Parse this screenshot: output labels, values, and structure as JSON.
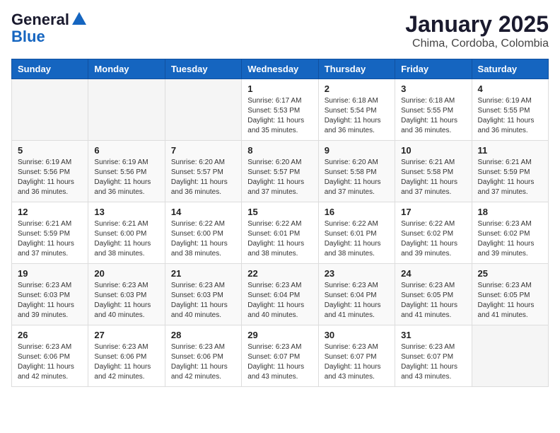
{
  "header": {
    "logo_line1": "General",
    "logo_line2": "Blue",
    "title": "January 2025",
    "subtitle": "Chima, Cordoba, Colombia"
  },
  "days_of_week": [
    "Sunday",
    "Monday",
    "Tuesday",
    "Wednesday",
    "Thursday",
    "Friday",
    "Saturday"
  ],
  "weeks": [
    [
      {
        "num": "",
        "sunrise": "",
        "sunset": "",
        "daylight": "",
        "empty": true
      },
      {
        "num": "",
        "sunrise": "",
        "sunset": "",
        "daylight": "",
        "empty": true
      },
      {
        "num": "",
        "sunrise": "",
        "sunset": "",
        "daylight": "",
        "empty": true
      },
      {
        "num": "1",
        "sunrise": "Sunrise: 6:17 AM",
        "sunset": "Sunset: 5:53 PM",
        "daylight": "Daylight: 11 hours and 35 minutes."
      },
      {
        "num": "2",
        "sunrise": "Sunrise: 6:18 AM",
        "sunset": "Sunset: 5:54 PM",
        "daylight": "Daylight: 11 hours and 36 minutes."
      },
      {
        "num": "3",
        "sunrise": "Sunrise: 6:18 AM",
        "sunset": "Sunset: 5:55 PM",
        "daylight": "Daylight: 11 hours and 36 minutes."
      },
      {
        "num": "4",
        "sunrise": "Sunrise: 6:19 AM",
        "sunset": "Sunset: 5:55 PM",
        "daylight": "Daylight: 11 hours and 36 minutes."
      }
    ],
    [
      {
        "num": "5",
        "sunrise": "Sunrise: 6:19 AM",
        "sunset": "Sunset: 5:56 PM",
        "daylight": "Daylight: 11 hours and 36 minutes."
      },
      {
        "num": "6",
        "sunrise": "Sunrise: 6:19 AM",
        "sunset": "Sunset: 5:56 PM",
        "daylight": "Daylight: 11 hours and 36 minutes."
      },
      {
        "num": "7",
        "sunrise": "Sunrise: 6:20 AM",
        "sunset": "Sunset: 5:57 PM",
        "daylight": "Daylight: 11 hours and 36 minutes."
      },
      {
        "num": "8",
        "sunrise": "Sunrise: 6:20 AM",
        "sunset": "Sunset: 5:57 PM",
        "daylight": "Daylight: 11 hours and 37 minutes."
      },
      {
        "num": "9",
        "sunrise": "Sunrise: 6:20 AM",
        "sunset": "Sunset: 5:58 PM",
        "daylight": "Daylight: 11 hours and 37 minutes."
      },
      {
        "num": "10",
        "sunrise": "Sunrise: 6:21 AM",
        "sunset": "Sunset: 5:58 PM",
        "daylight": "Daylight: 11 hours and 37 minutes."
      },
      {
        "num": "11",
        "sunrise": "Sunrise: 6:21 AM",
        "sunset": "Sunset: 5:59 PM",
        "daylight": "Daylight: 11 hours and 37 minutes."
      }
    ],
    [
      {
        "num": "12",
        "sunrise": "Sunrise: 6:21 AM",
        "sunset": "Sunset: 5:59 PM",
        "daylight": "Daylight: 11 hours and 37 minutes."
      },
      {
        "num": "13",
        "sunrise": "Sunrise: 6:21 AM",
        "sunset": "Sunset: 6:00 PM",
        "daylight": "Daylight: 11 hours and 38 minutes."
      },
      {
        "num": "14",
        "sunrise": "Sunrise: 6:22 AM",
        "sunset": "Sunset: 6:00 PM",
        "daylight": "Daylight: 11 hours and 38 minutes."
      },
      {
        "num": "15",
        "sunrise": "Sunrise: 6:22 AM",
        "sunset": "Sunset: 6:01 PM",
        "daylight": "Daylight: 11 hours and 38 minutes."
      },
      {
        "num": "16",
        "sunrise": "Sunrise: 6:22 AM",
        "sunset": "Sunset: 6:01 PM",
        "daylight": "Daylight: 11 hours and 38 minutes."
      },
      {
        "num": "17",
        "sunrise": "Sunrise: 6:22 AM",
        "sunset": "Sunset: 6:02 PM",
        "daylight": "Daylight: 11 hours and 39 minutes."
      },
      {
        "num": "18",
        "sunrise": "Sunrise: 6:23 AM",
        "sunset": "Sunset: 6:02 PM",
        "daylight": "Daylight: 11 hours and 39 minutes."
      }
    ],
    [
      {
        "num": "19",
        "sunrise": "Sunrise: 6:23 AM",
        "sunset": "Sunset: 6:03 PM",
        "daylight": "Daylight: 11 hours and 39 minutes."
      },
      {
        "num": "20",
        "sunrise": "Sunrise: 6:23 AM",
        "sunset": "Sunset: 6:03 PM",
        "daylight": "Daylight: 11 hours and 40 minutes."
      },
      {
        "num": "21",
        "sunrise": "Sunrise: 6:23 AM",
        "sunset": "Sunset: 6:03 PM",
        "daylight": "Daylight: 11 hours and 40 minutes."
      },
      {
        "num": "22",
        "sunrise": "Sunrise: 6:23 AM",
        "sunset": "Sunset: 6:04 PM",
        "daylight": "Daylight: 11 hours and 40 minutes."
      },
      {
        "num": "23",
        "sunrise": "Sunrise: 6:23 AM",
        "sunset": "Sunset: 6:04 PM",
        "daylight": "Daylight: 11 hours and 41 minutes."
      },
      {
        "num": "24",
        "sunrise": "Sunrise: 6:23 AM",
        "sunset": "Sunset: 6:05 PM",
        "daylight": "Daylight: 11 hours and 41 minutes."
      },
      {
        "num": "25",
        "sunrise": "Sunrise: 6:23 AM",
        "sunset": "Sunset: 6:05 PM",
        "daylight": "Daylight: 11 hours and 41 minutes."
      }
    ],
    [
      {
        "num": "26",
        "sunrise": "Sunrise: 6:23 AM",
        "sunset": "Sunset: 6:06 PM",
        "daylight": "Daylight: 11 hours and 42 minutes."
      },
      {
        "num": "27",
        "sunrise": "Sunrise: 6:23 AM",
        "sunset": "Sunset: 6:06 PM",
        "daylight": "Daylight: 11 hours and 42 minutes."
      },
      {
        "num": "28",
        "sunrise": "Sunrise: 6:23 AM",
        "sunset": "Sunset: 6:06 PM",
        "daylight": "Daylight: 11 hours and 42 minutes."
      },
      {
        "num": "29",
        "sunrise": "Sunrise: 6:23 AM",
        "sunset": "Sunset: 6:07 PM",
        "daylight": "Daylight: 11 hours and 43 minutes."
      },
      {
        "num": "30",
        "sunrise": "Sunrise: 6:23 AM",
        "sunset": "Sunset: 6:07 PM",
        "daylight": "Daylight: 11 hours and 43 minutes."
      },
      {
        "num": "31",
        "sunrise": "Sunrise: 6:23 AM",
        "sunset": "Sunset: 6:07 PM",
        "daylight": "Daylight: 11 hours and 43 minutes."
      },
      {
        "num": "",
        "sunrise": "",
        "sunset": "",
        "daylight": "",
        "empty": true
      }
    ]
  ]
}
